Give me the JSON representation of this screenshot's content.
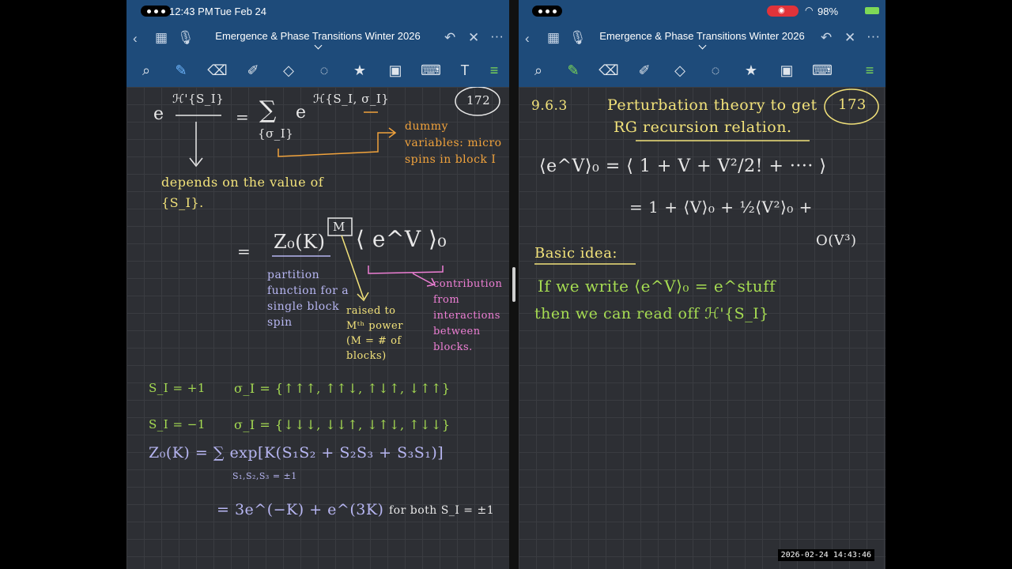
{
  "status": {
    "time": "12:43 PM",
    "date": "Tue Feb 24",
    "battery": "98%",
    "timestamp": "2026-02-24 14:43:46"
  },
  "left_pane": {
    "title": "Emergence & Phase Transitions Winter 2026",
    "page_number": "172",
    "notes": {
      "lhs_exp": "e",
      "lhs_sup": "ℋ'{S_I}",
      "eq1": "=",
      "sum_symbol": "∑",
      "sum_index": "{σ_I}",
      "rhs_exp": "e",
      "rhs_sup": "ℋ{S_I, σ_I}",
      "dummy_note": "dummy variables: micro spins in block I",
      "depends_note": "depends on the value of {S_I}.",
      "eq2": "=",
      "z0": "Z₀(K)",
      "m_box": "M",
      "bracket_exp": "⟨ e^V ⟩₀",
      "partition_note": "partition function for a single block spin",
      "raised_note": "raised to Mᵗʰ power (M = # of blocks)",
      "contribution_note": "contribution from interactions between blocks.",
      "s_plus": "S_I = +1",
      "sigma_plus": "σ_I = {↑↑↑, ↑↑↓, ↑↓↑, ↓↑↑}",
      "s_minus": "S_I = −1",
      "sigma_minus": "σ_I = {↓↓↓, ↓↓↑, ↓↑↓, ↑↓↓}",
      "z0_sum": "Z₀(K) = ∑ exp[K(S₁S₂ + S₂S₃ + S₃S₁)]",
      "z0_sum_index": "S₁,S₂,S₃ = ±1",
      "z0_result": "= 3e^(−K) + e^(3K)",
      "both_note": "for both S_I = ±1"
    }
  },
  "right_pane": {
    "title": "Emergence & Phase Transitions Winter 2026",
    "page_number": "173",
    "notes": {
      "section": "9.6.3",
      "heading_line1": "Perturbation theory to get",
      "heading_line2": "RG recursion relation.",
      "exp_line1": "⟨e^V⟩₀ = ⟨ 1 + V + V²/2! + ···· ⟩",
      "exp_line2": "= 1 + ⟨V⟩₀ + ½⟨V²⟩₀ +",
      "exp_line3": "O(V³)",
      "basic_idea": "Basic idea:",
      "idea_line1": "If we write ⟨e^V⟩₀ = e^stuff",
      "idea_line2": "then we can read off ℋ'{S_I}"
    }
  },
  "colors": {
    "toolbar": "#1e4b7a",
    "canvas": "#2d2f34",
    "pen_yellow": "#f2e27a",
    "pen_orange": "#f0a23c",
    "pen_purple": "#b7b6f2",
    "pen_magenta": "#ee7fd5",
    "pen_green": "#a6dc52"
  },
  "icons": {
    "toolbar": [
      "back-chevron-icon",
      "grid-icon",
      "mic-icon",
      "undo-icon",
      "close-icon",
      "more-icon"
    ],
    "tools": [
      "lasso-photo-icon",
      "pen-icon",
      "eraser-icon",
      "highlighter-icon",
      "shapes-icon",
      "lasso-icon",
      "sticker-icon",
      "image-icon",
      "keyboard-icon",
      "text-icon"
    ]
  }
}
